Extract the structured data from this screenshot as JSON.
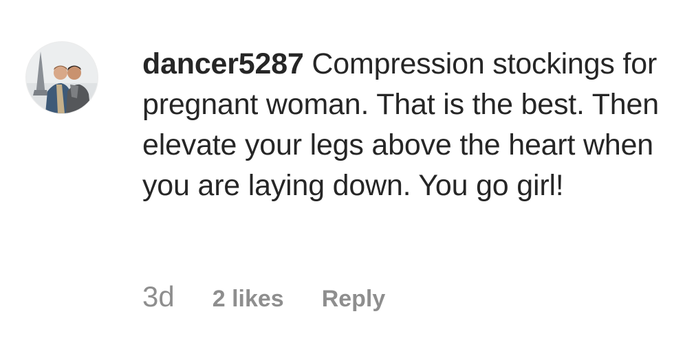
{
  "comment": {
    "avatar_icon": "user-avatar-photo-icon",
    "username": "dancer5287",
    "text": "Compression stockings for pregnant woman. That is the best. Then elevate your legs above the heart when you are laying down. You go girl!",
    "timestamp": "3d",
    "likes": "2 likes",
    "reply_label": "Reply"
  },
  "colors": {
    "primary_text": "#262626",
    "secondary_text": "#8e8e8e",
    "background": "#ffffff"
  }
}
